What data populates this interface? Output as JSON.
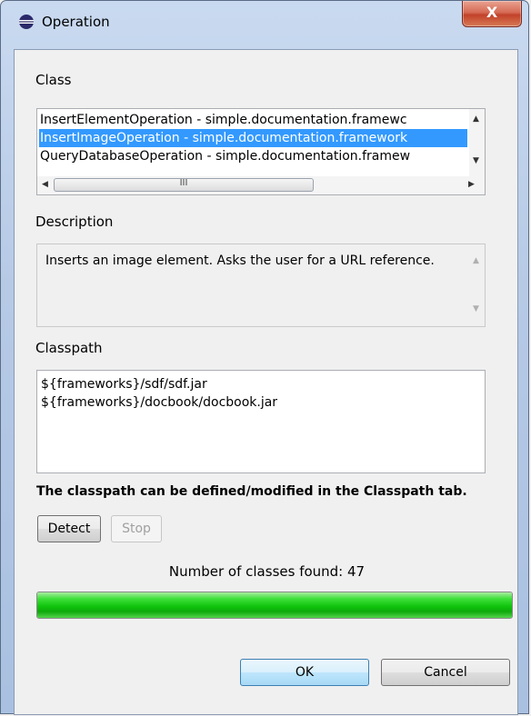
{
  "window": {
    "title": "Operation",
    "close_glyph": "X",
    "icon": "eclipse-icon"
  },
  "class_section": {
    "label": "Class",
    "items": [
      "InsertElementOperation - simple.documentation.framewc",
      "InsertImageOperation - simple.documentation.framework",
      "QueryDatabaseOperation - simple.documentation.framew"
    ],
    "selected_index": 1,
    "hscroll_thumb_glyph": "III"
  },
  "description_section": {
    "label": "Description",
    "text": "Inserts an image element. Asks the user for a URL reference."
  },
  "classpath_section": {
    "label": "Classpath",
    "entries": [
      "${frameworks}/sdf/sdf.jar",
      "${frameworks}/docbook/docbook.jar"
    ],
    "hint": "The classpath can be defined/modified in the Classpath tab."
  },
  "detection": {
    "detect_label": "Detect",
    "stop_label": "Stop",
    "count_text": "Number of classes found: 47",
    "progress_fraction": 1.0
  },
  "footer": {
    "ok_label": "OK",
    "cancel_label": "Cancel"
  },
  "colors": {
    "selection": "#3399ff",
    "progress_green": "#10c40d",
    "close_red": "#c2412a"
  }
}
